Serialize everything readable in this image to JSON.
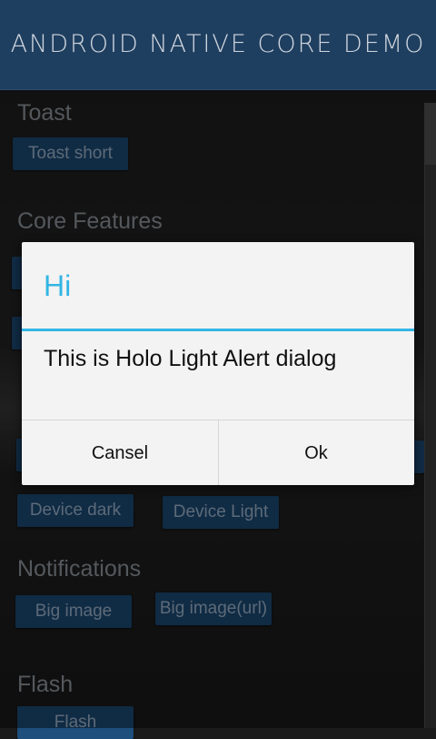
{
  "header": {
    "title": "Android Native Core Demo"
  },
  "sections": {
    "toast": {
      "title": "Toast",
      "buttons": [
        "Toast short"
      ]
    },
    "core": {
      "title": "Core Features"
    },
    "theme": {
      "buttons": [
        "Device dark",
        "Device Light"
      ]
    },
    "notifications": {
      "title": "Notifications",
      "buttons": [
        "Big image",
        "Big image(url)"
      ]
    },
    "flash": {
      "title": "Flash",
      "buttons": [
        "Flash"
      ]
    }
  },
  "dialog": {
    "title": "Hi",
    "message": "This is Holo Light Alert dialog",
    "negative_label": "Cansel",
    "positive_label": "Ok"
  },
  "colors": {
    "header_bg": "#1f3f60",
    "button_bg": "#1e4f7d",
    "accent": "#33b5e5"
  }
}
